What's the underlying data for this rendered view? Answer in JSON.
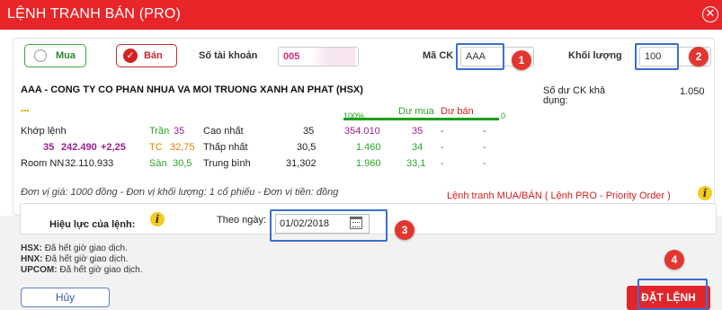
{
  "dialog": {
    "title": "LỆNH TRANH BÁN (PRO)",
    "close_glyph": "✕"
  },
  "order": {
    "buy_label": "Mua",
    "sell_label": "Bán",
    "account_label": "Số tài khoản",
    "account_value": "005",
    "symbol_label": "Mã CK",
    "symbol_value": "AAA",
    "qty_label": "Khối lượng",
    "qty_value": "100",
    "balance_label": "Số dư CK khả dụng:",
    "balance_value": "1.050"
  },
  "stock": {
    "title": "AAA - CONG TY CO PHAN NHUA VA MOI TRUONG XANH AN PHAT (HSX)",
    "match_label": "Khớp lệnh",
    "match_price": "35",
    "match_vol": "242.490",
    "match_change": "+2,25",
    "ceiling_label": "Trần",
    "ceiling_value": "35",
    "ref_label": "TC",
    "ref_value": "32,75",
    "floor_label": "Sàn",
    "floor_value": "30,5",
    "high_label": "Cao nhất",
    "high_value": "35",
    "low_label": "Thấp nhất",
    "low_value": "30,5",
    "avg_label": "Trung bình",
    "avg_value": "31,302",
    "room_label": "Room NN",
    "room_value": "32.110.933",
    "bid_header": "Dư mua",
    "ask_header": "Dư bán",
    "bar_100": "100%",
    "bar_0": "0",
    "depth": [
      {
        "vol": "354.010",
        "bid": "35",
        "ask": "-",
        "ask_vol": "-"
      },
      {
        "vol": "1.460",
        "bid": "34",
        "ask": "-",
        "ask_vol": "-"
      },
      {
        "vol": "1.960",
        "bid": "33,1",
        "ask": "-",
        "ask_vol": "-"
      }
    ]
  },
  "units_text": "Đơn vị giá: 1000 đồng - Đơn vị khối lượng: 1 cổ phiếu - Đơn vị tiền: đồng",
  "order_type_text": "Lệnh tranh MUA/BÁN ( Lệnh PRO - Priority Order )",
  "validity": {
    "label": "Hiệu lực của lệnh:",
    "by_date_label": "Theo ngày:",
    "date_value": "01/02/2018"
  },
  "markets": [
    {
      "name": "HSX:",
      "status": "Đã hết giờ giao dịch."
    },
    {
      "name": "HNX:",
      "status": "Đã hết giờ giao dịch."
    },
    {
      "name": "UPCOM:",
      "status": "Đã hết giờ giao dịch."
    }
  ],
  "buttons": {
    "cancel": "Hủy",
    "submit": "ĐẶT LỆNH"
  },
  "steps": [
    "1",
    "2",
    "3",
    "4"
  ],
  "colors": {
    "header": "#e8262a",
    "buy": "#2aa52a",
    "sell": "#cc2a2a",
    "highlight": "#3b6fd1",
    "step": "#e3362f"
  }
}
